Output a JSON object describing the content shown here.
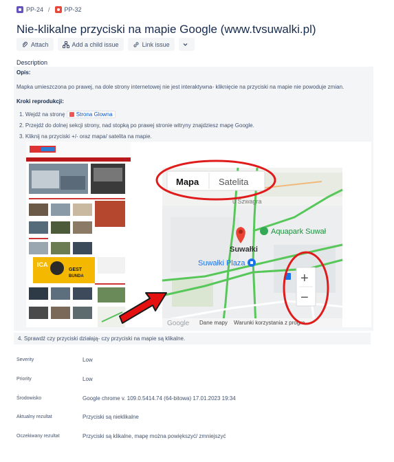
{
  "breadcrumb": {
    "parent": "PP-24",
    "current": "PP-32",
    "separator": "/"
  },
  "issue": {
    "title": "Nie-klikalne przyciski na mapie Google (www.tvsuwalki.pl)"
  },
  "actions": {
    "attach": "Attach",
    "add_child": "Add a child issue",
    "link_issue": "Link issue"
  },
  "description": {
    "label": "Description",
    "opis_heading": "Opis:",
    "opis_text": "Mapka umieszczona po prawej, na dole strony internetowej nie jest interaktywna- kliknięcie na przyciski na mapie nie powoduje zmian.",
    "kroki_heading": "Kroki reprodukcji:",
    "step1_prefix": "1. Wejdź na stronę",
    "step1_link": "Strona Glowna",
    "step2": "2. Przejdź do dolnej sekcji strony, nad stopką po prawej stronie witryny znajdziesz mapę Google.",
    "step3": "3. Kliknij na przyciski +/- oraz mapa/ satelita na mapie.",
    "step4": "4. Sprawdź czy przyciski działają- czy przyciski na mapie są klikalne."
  },
  "screenshot": {
    "map_tab": "Mapa",
    "satellite_tab": "Satelita",
    "city": "Suwałki",
    "plaza": "Suwałki Plaza",
    "aquapark": "Aquapark Suwał",
    "street": "u Szwagra",
    "zoom_in": "+",
    "zoom_out": "−",
    "map_data": "Dane mapy",
    "terms": "Warunki korzystania z progra",
    "logo": "Google",
    "ad_brand": "ICA",
    "ad_text1": "GEST",
    "ad_text2": "BUNDA"
  },
  "fields": [
    {
      "label": "Severity",
      "value": "Low"
    },
    {
      "label": "Priority",
      "value": "Low"
    },
    {
      "label": "Środowisko",
      "value": "Google chrome v. 109.0.5414.74 (64-bitowa) 17.01.2023 19:34"
    },
    {
      "label": "Aktualny rezultat",
      "value": "Przyciski są nieklikalne"
    },
    {
      "label": "Oczekiwany rezultat",
      "value": "Przyciski są klikalne, mapę można powiększyć/ zmniejszyć"
    }
  ],
  "colors": {
    "accent": "#0052cc",
    "annotation_red": "#e01b1b",
    "panel_bg": "#f4f5f7"
  }
}
